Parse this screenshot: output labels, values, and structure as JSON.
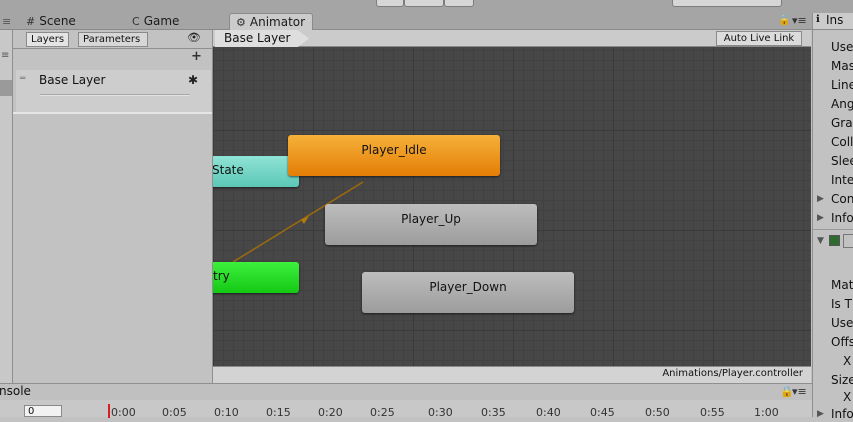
{
  "tabs": [
    {
      "icon": "#",
      "label": "Scene"
    },
    {
      "icon": "C",
      "label": "Game"
    },
    {
      "icon": "⚙",
      "label": "Animator"
    }
  ],
  "inspector": {
    "tab_label": "Ins",
    "rows": [
      "Use",
      "Mas",
      "Line",
      "Ang",
      "Gra",
      "Coll",
      "Slee",
      "Inte",
      "Con",
      "Info",
      "Mate",
      "Is T",
      "Use",
      "Offs",
      "X",
      "Size",
      "X",
      "Info"
    ]
  },
  "layers_panel": {
    "tab_layers": "Layers",
    "tab_parameters": "Parameters",
    "add_symbol": "+",
    "layer_name": "Base Layer"
  },
  "graph": {
    "breadcrumb": "Base Layer",
    "auto_live_link": "Auto Live Link",
    "footer_path": "Animations/Player.controller",
    "nodes": {
      "any_state": "State",
      "player_idle": "Player_Idle",
      "player_up": "Player_Up",
      "player_down": "Player_Down",
      "entry": "try"
    }
  },
  "console": {
    "title": "nsole",
    "frame_value": "0",
    "ticks": [
      "0:00",
      "0:05",
      "0:10",
      "0:15",
      "0:20",
      "0:25",
      "0:30",
      "0:35",
      "0:40",
      "0:45",
      "0:50",
      "0:55",
      "1:00"
    ]
  },
  "colors": {
    "graph_bg": "#474747",
    "default_state": "#e88a0a",
    "entry_node": "#19d019",
    "any_state": "#6fd4c4",
    "normal_state": "#a8a8a8",
    "transition": "#9e6b0c",
    "playhead": "#d81e1e"
  }
}
